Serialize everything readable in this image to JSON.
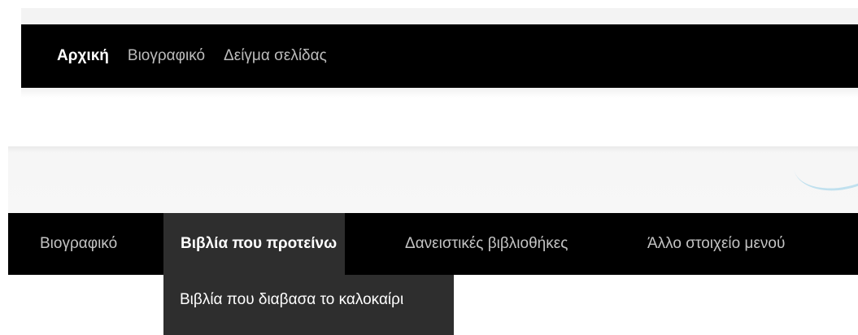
{
  "top_nav": {
    "items": [
      {
        "label": "Αρχική",
        "active": true
      },
      {
        "label": "Βιογραφικό",
        "active": false
      },
      {
        "label": "Δείγμα σελίδας",
        "active": false
      }
    ]
  },
  "main_nav": {
    "items": [
      {
        "label": "Βιογραφικό",
        "active": false
      },
      {
        "label": "Βιβλία που προτείνω",
        "active": true
      },
      {
        "label": "Δανειστικές βιβλιοθήκες",
        "active": false
      },
      {
        "label": "Άλλο στοιχείο μενού",
        "active": false
      }
    ],
    "submenu": [
      {
        "label": "Βιβλία που διαβασα το καλοκαίρι"
      }
    ]
  },
  "colors": {
    "nav_background": "#000000",
    "active_item_background": "#2e2e2e",
    "inactive_text": "#c3c3c3",
    "active_text": "#ffffff"
  }
}
